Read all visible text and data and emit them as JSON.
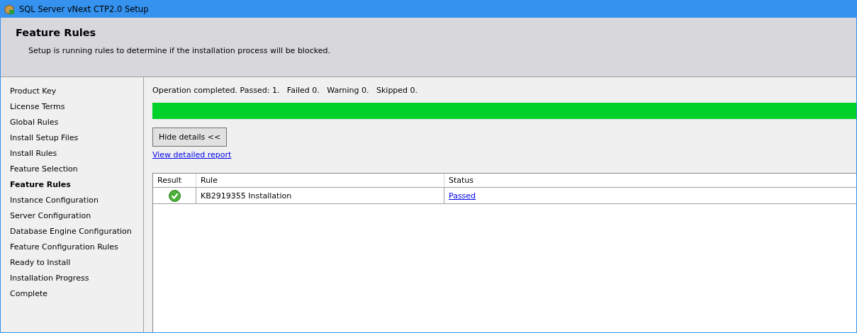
{
  "window": {
    "title": "SQL Server vNext CTP2.0 Setup"
  },
  "header": {
    "title": "Feature Rules",
    "description": "Setup is running rules to determine if the installation process will be blocked."
  },
  "sidebar": {
    "items": [
      {
        "label": "Product Key",
        "selected": false
      },
      {
        "label": "License Terms",
        "selected": false
      },
      {
        "label": "Global Rules",
        "selected": false
      },
      {
        "label": "Install Setup Files",
        "selected": false
      },
      {
        "label": "Install Rules",
        "selected": false
      },
      {
        "label": "Feature Selection",
        "selected": false
      },
      {
        "label": "Feature Rules",
        "selected": true
      },
      {
        "label": "Instance Configuration",
        "selected": false
      },
      {
        "label": "Server Configuration",
        "selected": false
      },
      {
        "label": "Database Engine Configuration",
        "selected": false
      },
      {
        "label": "Feature Configuration Rules",
        "selected": false
      },
      {
        "label": "Ready to Install",
        "selected": false
      },
      {
        "label": "Installation Progress",
        "selected": false
      },
      {
        "label": "Complete",
        "selected": false
      }
    ]
  },
  "status": {
    "message": "Operation completed. Passed: 1.   Failed 0.   Warning 0.   Skipped 0.",
    "progress": {
      "level": 1
    }
  },
  "details_button": "Hide details <<",
  "report_link": "View detailed report",
  "table": {
    "columns": [
      "Result",
      "Rule",
      "Status"
    ],
    "rows": [
      {
        "passed": true,
        "rule": "KB2919355 Installation",
        "status": "Passed"
      }
    ]
  }
}
